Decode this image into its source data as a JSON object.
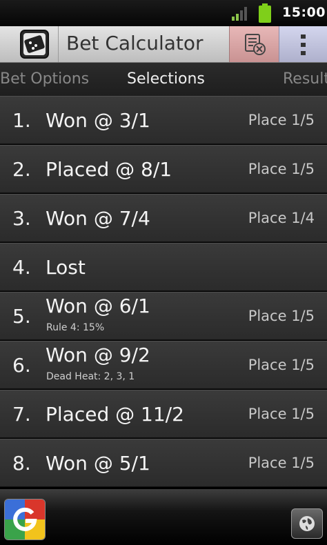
{
  "status": {
    "time": "15:00"
  },
  "app": {
    "title": "Bet Calculator"
  },
  "tabs": {
    "left": "Bet Options",
    "active": "Selections",
    "right": "Result"
  },
  "selections": [
    {
      "num": "1.",
      "result": "Won @ 3/1",
      "sub": "",
      "place": "Place 1/5"
    },
    {
      "num": "2.",
      "result": "Placed @ 8/1",
      "sub": "",
      "place": "Place 1/5"
    },
    {
      "num": "3.",
      "result": "Won @ 7/4",
      "sub": "",
      "place": "Place 1/4"
    },
    {
      "num": "4.",
      "result": "Lost",
      "sub": "",
      "place": ""
    },
    {
      "num": "5.",
      "result": "Won @ 6/1",
      "sub": "Rule 4: 15%",
      "place": "Place 1/5"
    },
    {
      "num": "6.",
      "result": "Won @ 9/2",
      "sub": "Dead Heat: 2, 3, 1",
      "place": "Place 1/5"
    },
    {
      "num": "7.",
      "result": "Placed @ 11/2",
      "sub": "",
      "place": "Place 1/5"
    },
    {
      "num": "8.",
      "result": "Won @ 5/1",
      "sub": "",
      "place": "Place 1/5"
    }
  ],
  "icons": {
    "signal": "signal-icon",
    "battery": "battery-icon",
    "app": "calculator-app-icon",
    "clear": "clear-selections-icon",
    "menu": "overflow-menu-icon",
    "google": "google-search-icon",
    "globe": "browser-globe-icon"
  }
}
